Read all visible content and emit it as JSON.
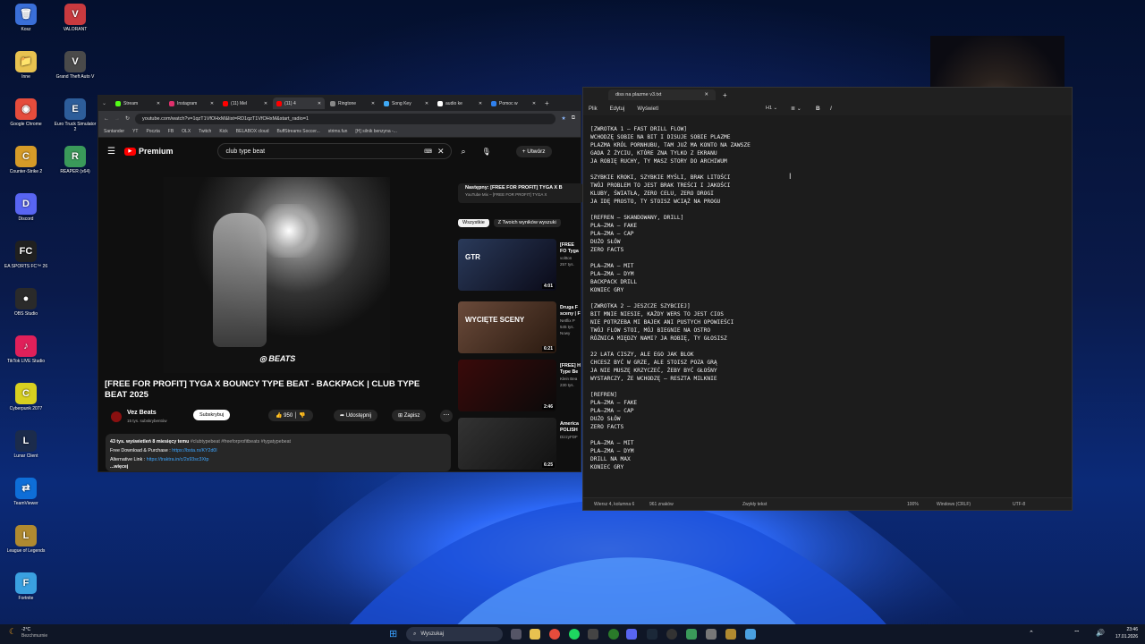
{
  "desktop": {
    "icons": [
      {
        "label": "Kosz",
        "glyph": "🗑",
        "color": "#3a6fd8"
      },
      {
        "label": "VALORANT",
        "glyph": "V",
        "color": "#c93a3f"
      },
      {
        "label": "Inne",
        "glyph": "📁",
        "color": "#e8c250"
      },
      {
        "label": "Grand Theft Auto V",
        "glyph": "V",
        "color": "#4a4a4a"
      },
      {
        "label": "Google Chrome",
        "glyph": "◉",
        "color": "#e54c3c"
      },
      {
        "label": "Euro Truck Simulator 2",
        "glyph": "E",
        "color": "#2d5d9a"
      },
      {
        "label": "Counter-Strike 2",
        "glyph": "C",
        "color": "#d69b28"
      },
      {
        "label": "REAPER (x64)",
        "glyph": "R",
        "color": "#3a9a5a"
      },
      {
        "label": "Discord",
        "glyph": "D",
        "color": "#5865f2"
      },
      {
        "label": "EA SPORTS FC™ 26",
        "glyph": "FC",
        "color": "#202020"
      },
      {
        "label": "OBS Studio",
        "glyph": "●",
        "color": "#2a2a2a"
      },
      {
        "label": "TikTok LIVE Studio",
        "glyph": "♪",
        "color": "#e0205a"
      },
      {
        "label": "Cyberpunk 2077",
        "glyph": "C",
        "color": "#d8d020"
      },
      {
        "label": "Lunar Client",
        "glyph": "L",
        "color": "#1b2b4b"
      },
      {
        "label": "TeamViewer",
        "glyph": "⇄",
        "color": "#0e6ed8"
      },
      {
        "label": "League of Legends",
        "glyph": "L",
        "color": "#b08a30"
      },
      {
        "label": "Fortnite",
        "glyph": "F",
        "color": "#3aa0e0"
      }
    ]
  },
  "browser": {
    "tabs": [
      {
        "label": "Stream",
        "color": "#53fc18"
      },
      {
        "label": "Instagram",
        "color": "#e1306c"
      },
      {
        "label": "(11) Mel",
        "color": "#ff0000"
      },
      {
        "label": "(11) 4",
        "color": "#ff0000"
      },
      {
        "label": "Ringtone",
        "color": "#888888"
      },
      {
        "label": "Song Key",
        "color": "#3fa9f5"
      },
      {
        "label": "audio ke",
        "color": "#ffffff"
      },
      {
        "label": "Pomoc w",
        "color": "#2f80ed"
      }
    ],
    "url": "youtube.com/watch?v=1qzT1VfOHxM&list=RD1qzT1VfOHxM&start_radio=1",
    "bookmarks": [
      "Santander",
      "YT",
      "Poczta",
      "FB",
      "OLX",
      "Twitch",
      "Kick",
      "BELABOX cloud",
      "BuffStreams Soccer...",
      "strims.fun",
      "[H] silnik benzyna -..."
    ]
  },
  "youtube": {
    "logo_text": "Premium",
    "search_query": "club type beat",
    "create_label": "Utwórz",
    "video_overlay": "BEATS",
    "video_title": "[FREE FOR PROFIT] TYGA X BOUNCY TYPE BEAT - BACKPACK | CLUB TYPE BEAT 2025",
    "channel": "Vez Beats",
    "subscribers": "15 tys. subskrybentów",
    "subscribe_label": "Subskrybuj",
    "likes": "950",
    "share_label": "Udostępnij",
    "save_label": "Zapisz",
    "desc_line1": "43 tys. wyświetleń 8 miesięcy temu",
    "desc_tags": "#clubtypebeat #freeforprofitbeats #tygatypebeat",
    "desc_line2_label": "Free Download & Purchase : ",
    "desc_line2_link": "https://bsta.rs/KY2d0l",
    "desc_line3_label": "Alternative Link : ",
    "desc_line3_link": "https://traktra.in/c/2s93sc3Xtp",
    "more_label": "...więcej",
    "next_label": "Następny: [FREE FOR PROFIT] TYGA X B",
    "next_sub": "YouTube Mix – [FREE FOR PROFIT] TYGA X",
    "chip_all": "Wszystkie",
    "chip_results": "Z Twoich wyników wyszuki",
    "sidebar": [
      {
        "title": "[FREE FO Tyga x C",
        "channel": "voltton",
        "meta": "257 tys.",
        "duration": "4:01",
        "thumb_text": "GTR"
      },
      {
        "title": "Druga F sceny | F",
        "channel": "Netflix P",
        "meta": "545 tys.",
        "badge": "Nowy",
        "duration": "6:21",
        "thumb_text": "WYCIĘTE SCENY"
      },
      {
        "title": "[FREE] H Type Be",
        "channel": "Klein Bea",
        "meta": "230 tys.",
        "duration": "2:46",
        "thumb_text": ""
      },
      {
        "title": "America POLISH",
        "channel": "DizzyFDF",
        "meta": "",
        "duration": "6:25",
        "thumb_text": ""
      }
    ]
  },
  "notepad": {
    "tab_title": "diss na plazme v3.txt",
    "menu": [
      "Plik",
      "Edytuj",
      "Wyświetl"
    ],
    "heading_control": "H1",
    "lines": [
      "[ZWROTKA 1 – FAST DRILL FLOW]",
      "WCHODZĘ SOBIE NA BIT I DISUJE SOBIE PLAZME",
      "PLAZMA KRÓL PORNHUBU, TAM JUŻ MA KONTO NA ZAWSZE",
      "GADA Ż ŻYCIU, KTÓRE ZNA TYLKO Z EKRANU",
      "JA ROBIĘ RUCHY, TY MASZ STORY DO ARCHIWUM",
      "",
      "SZYBKIE KROKI, SZYBKIE MYŚLI, BRAK LITOŚCI",
      "TWÓJ PROBLEM TO JEST BRAK TREŚCI I JAKOŚCI",
      "KLUBY, ŚWIATŁA, ZERO CELU, ZERO DROGI",
      "JA IDĘ PROSTO, TY STOISZ WCIĄŻ NA PROGU",
      "",
      "[REFREN – SKANDOWANY, DRILL]",
      "PLA–ZMA – FAKE",
      "PLA–ZMA – CAP",
      "DUŻO SŁÓW",
      "ZERO FACTS",
      "",
      "PLA–ZMA – MIT",
      "PLA–ZMA – DYM",
      "BACKPACK DRILL",
      "KONIEC GRY",
      "",
      "[ZWROTKA 2 – JESZCZE SZYBCIEJ]",
      "BIT MNIE NIESIE, KAŻDY WERS TO JEST CIOS",
      "NIE POTRZEBA MI BAJEK ANI PUSTYCH OPOWIEŚCI",
      "TWÓJ FLOW STOI, MÓJ BIEGNIE NA OSTRO",
      "RÓŻNICA MIĘDZY NAMI? JA ROBIĘ, TY GŁOSISZ",
      "",
      "22 LATA CISZY, ALE EGO JAK BLOK",
      "CHCESZ BYĆ W GRZE, ALE STOISZ POZA GRĄ",
      "JA NIE MUSZĘ KRZYCZEĆ, ŻEBY BYĆ GŁOŚNY",
      "WYSTARCZY, ŻE WCHODZĘ – RESZTA MILKNIE",
      "",
      "[REFREN]",
      "PLA–ZMA – FAKE",
      "PLA–ZMA – CAP",
      "DUŻO SŁÓW",
      "ZERO FACTS",
      "",
      "PLA–ZMA – MIT",
      "PLA–ZMA – DYM",
      "DRILL NA MAX",
      "KONIEC GRY"
    ],
    "status": {
      "position": "Wiersz 4, kolumna 6",
      "chars": "961 znaków",
      "format": "Zwykły tekst",
      "zoom": "100%",
      "eol": "Windows (CRLF)",
      "encoding": "UTF-8"
    }
  },
  "taskbar": {
    "weather_temp": "-2°C",
    "weather_desc": "Bezchmurnie",
    "search_label": "Wyszukaj",
    "time": "23:46",
    "date": "17.01.2026"
  }
}
